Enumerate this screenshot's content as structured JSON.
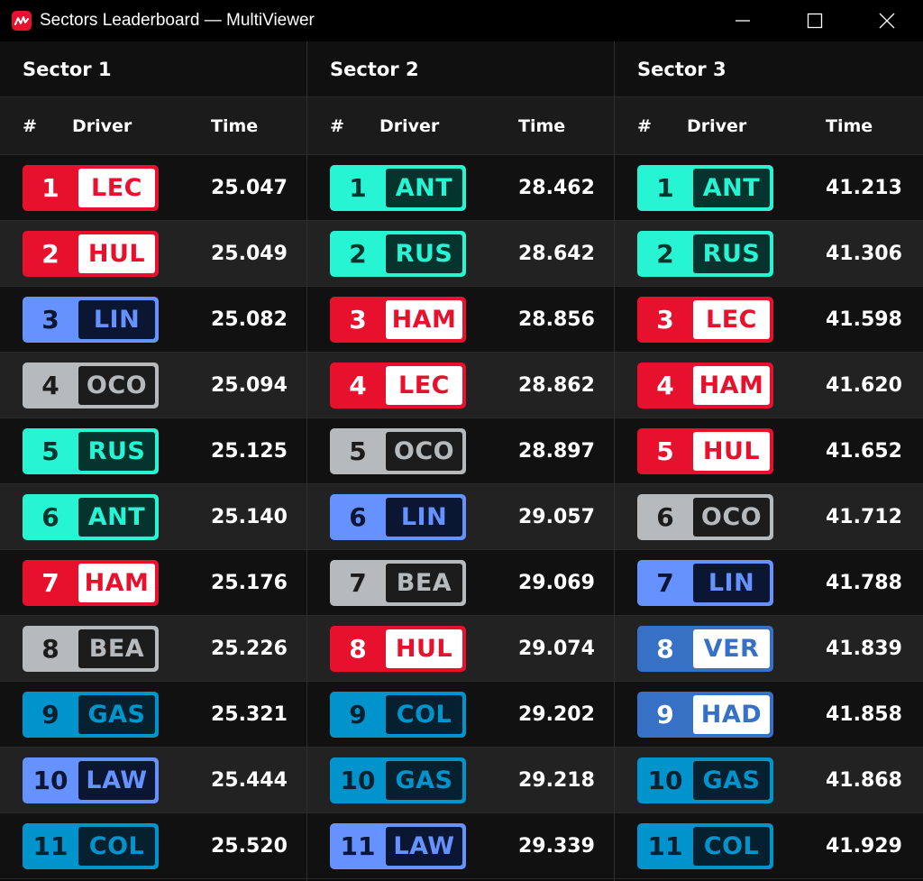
{
  "window": {
    "title": "Sectors Leaderboard — MultiViewer",
    "app_icon": "multiviewer-logo-icon",
    "controls": [
      "minimize-icon",
      "maximize-icon",
      "close-icon"
    ]
  },
  "headers": {
    "pos": "#",
    "driver": "Driver",
    "time": "Time"
  },
  "teams": {
    "ferrari": {
      "base": "#e8112d",
      "inner": "#ffffff",
      "text": "#e8112d",
      "pos_text": "#ffffff"
    },
    "haas": {
      "base": "#b6babd",
      "inner": "#1c1c1c",
      "text": "#b6babd",
      "pos_text": "#1c1c1c"
    },
    "rb": {
      "base": "#6692ff",
      "inner": "#0b1633",
      "text": "#6692ff",
      "pos_text": "#0b1633"
    },
    "alpine": {
      "base": "#0093cc",
      "inner": "#05202e",
      "text": "#0093cc",
      "pos_text": "#05202e"
    },
    "mercedes": {
      "base": "#27f4d2",
      "inner": "#05342e",
      "text": "#27f4d2",
      "pos_text": "#05342e"
    },
    "redbull": {
      "base": "#3671c6",
      "inner": "#ffffff",
      "text": "#3671c6",
      "pos_text": "#ffffff"
    },
    "ferrari_alt": {
      "base": "#e8112d",
      "inner": "#ffffff",
      "text": "#e8112d",
      "pos_text": "#ffffff"
    }
  },
  "sectors": [
    {
      "name": "Sector 1",
      "rows": [
        {
          "pos": "1",
          "driver": "LEC",
          "team": "ferrari",
          "time": "25.047"
        },
        {
          "pos": "2",
          "driver": "HUL",
          "team": "ferrari",
          "time": "25.049"
        },
        {
          "pos": "3",
          "driver": "LIN",
          "team": "rb",
          "time": "25.082"
        },
        {
          "pos": "4",
          "driver": "OCO",
          "team": "haas",
          "time": "25.094"
        },
        {
          "pos": "5",
          "driver": "RUS",
          "team": "mercedes",
          "time": "25.125"
        },
        {
          "pos": "6",
          "driver": "ANT",
          "team": "mercedes",
          "time": "25.140"
        },
        {
          "pos": "7",
          "driver": "HAM",
          "team": "ferrari",
          "time": "25.176"
        },
        {
          "pos": "8",
          "driver": "BEA",
          "team": "haas",
          "time": "25.226"
        },
        {
          "pos": "9",
          "driver": "GAS",
          "team": "alpine",
          "time": "25.321"
        },
        {
          "pos": "10",
          "driver": "LAW",
          "team": "rb",
          "time": "25.444"
        },
        {
          "pos": "11",
          "driver": "COL",
          "team": "alpine",
          "time": "25.520"
        }
      ]
    },
    {
      "name": "Sector 2",
      "rows": [
        {
          "pos": "1",
          "driver": "ANT",
          "team": "mercedes",
          "time": "28.462"
        },
        {
          "pos": "2",
          "driver": "RUS",
          "team": "mercedes",
          "time": "28.642"
        },
        {
          "pos": "3",
          "driver": "HAM",
          "team": "ferrari",
          "time": "28.856"
        },
        {
          "pos": "4",
          "driver": "LEC",
          "team": "ferrari",
          "time": "28.862"
        },
        {
          "pos": "5",
          "driver": "OCO",
          "team": "haas",
          "time": "28.897"
        },
        {
          "pos": "6",
          "driver": "LIN",
          "team": "rb",
          "time": "29.057"
        },
        {
          "pos": "7",
          "driver": "BEA",
          "team": "haas",
          "time": "29.069"
        },
        {
          "pos": "8",
          "driver": "HUL",
          "team": "ferrari",
          "time": "29.074"
        },
        {
          "pos": "9",
          "driver": "COL",
          "team": "alpine",
          "time": "29.202"
        },
        {
          "pos": "10",
          "driver": "GAS",
          "team": "alpine",
          "time": "29.218"
        },
        {
          "pos": "11",
          "driver": "LAW",
          "team": "rb",
          "time": "29.339"
        }
      ]
    },
    {
      "name": "Sector 3",
      "rows": [
        {
          "pos": "1",
          "driver": "ANT",
          "team": "mercedes",
          "time": "41.213"
        },
        {
          "pos": "2",
          "driver": "RUS",
          "team": "mercedes",
          "time": "41.306"
        },
        {
          "pos": "3",
          "driver": "LEC",
          "team": "ferrari",
          "time": "41.598"
        },
        {
          "pos": "4",
          "driver": "HAM",
          "team": "ferrari",
          "time": "41.620"
        },
        {
          "pos": "5",
          "driver": "HUL",
          "team": "ferrari",
          "time": "41.652"
        },
        {
          "pos": "6",
          "driver": "OCO",
          "team": "haas",
          "time": "41.712"
        },
        {
          "pos": "7",
          "driver": "LIN",
          "team": "rb",
          "time": "41.788"
        },
        {
          "pos": "8",
          "driver": "VER",
          "team": "redbull",
          "time": "41.839"
        },
        {
          "pos": "9",
          "driver": "HAD",
          "team": "redbull",
          "time": "41.858"
        },
        {
          "pos": "10",
          "driver": "GAS",
          "team": "alpine",
          "time": "41.868"
        },
        {
          "pos": "11",
          "driver": "COL",
          "team": "alpine",
          "time": "41.929"
        }
      ]
    }
  ]
}
